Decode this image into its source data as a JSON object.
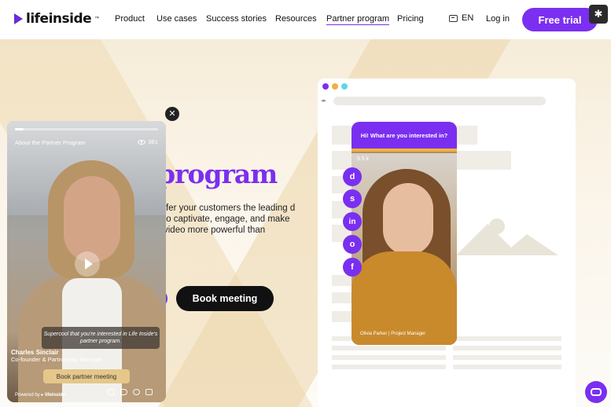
{
  "nav": {
    "brand": "lifeinside",
    "brand_tm": "™",
    "items": [
      "Product",
      "Use cases",
      "Success stories",
      "Resources",
      "Partner program",
      "Pricing"
    ],
    "lang": "EN",
    "login": "Log in",
    "cta": "Free trial"
  },
  "hero": {
    "title": "program",
    "description": "ffer your customers the leading d to captivate, engage, and make video more powerful than",
    "book_label": "Book meeting"
  },
  "video_widget": {
    "title": "About the Partner Program",
    "views": "361",
    "caption": "Supercool that you're interested in Life Inside's partner program.",
    "person_name": "Charles Sinclair",
    "person_role": "Co-founder & Partnership Manager",
    "cta": "Book partner meeting",
    "powered_by": "Powered by",
    "powered_brand": "lifeinside",
    "close": "✕",
    "progress": 0.06
  },
  "phone_widget": {
    "bubble": "Hi! What are you interested in?",
    "views": "5.5 k",
    "person": "Olivia Parker",
    "role": "Project Manager",
    "socials": [
      "d",
      "s",
      "in",
      "o",
      "f"
    ]
  },
  "colors": {
    "brand": "#7a2ff0",
    "dark_button": "#111111",
    "accent_yellow": "#f0b140"
  },
  "icons": {
    "brand": "play-triangle-icon",
    "lang": "translate-icon",
    "hubspot": "hubspot-icon",
    "chat": "chat-icon"
  }
}
